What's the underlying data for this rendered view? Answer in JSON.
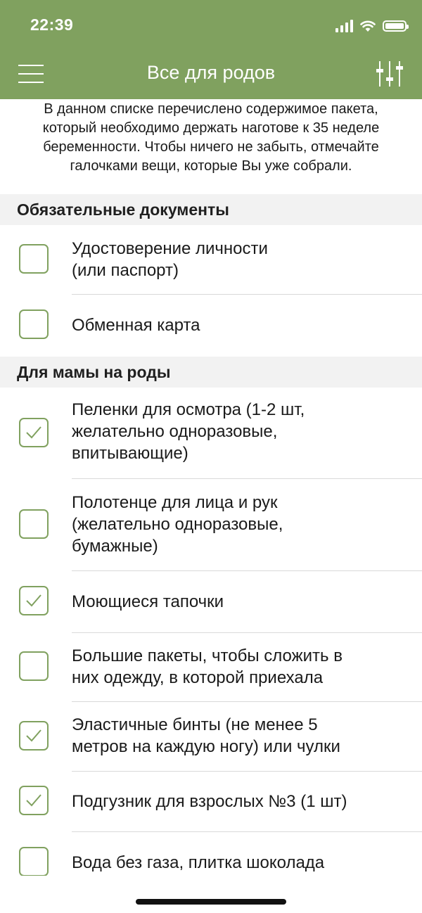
{
  "status_bar": {
    "time": "22:39"
  },
  "nav": {
    "title": "Все для родов",
    "left_icon": "hamburger-menu-icon",
    "right_icon": "filter-sliders-icon"
  },
  "intro_text": "В данном списке перечислено содержимое пакета, который необходимо держать наготове к 35 неделе беременности. Чтобы ничего не забыть, отмечайте галочками вещи, которые Вы уже собрали.",
  "sections": [
    {
      "title": "Обязательные документы",
      "items": [
        {
          "label": "Удостоверение личности\n(или паспорт)",
          "checked": false
        },
        {
          "label": "Обменная карта",
          "checked": false
        }
      ]
    },
    {
      "title": "Для мамы на роды",
      "items": [
        {
          "label": "Пеленки для осмотра (1-2 шт,\nжелательно одноразовые,\nвпитывающие)",
          "checked": true
        },
        {
          "label": "Полотенце для лица и рук\n(желательно одноразовые,\nбумажные)",
          "checked": false
        },
        {
          "label": "Моющиеся тапочки",
          "checked": true
        },
        {
          "label": "Большие пакеты, чтобы сложить в\nних одежду, в которой приехала",
          "checked": false
        },
        {
          "label": "Эластичные бинты (не менее 5\nметров на каждую ногу) или чулки",
          "checked": true
        },
        {
          "label": "Подгузник для взрослых №3 (1 шт)",
          "checked": true
        },
        {
          "label": "Вода без газа, плитка шоколада",
          "checked": false
        }
      ]
    }
  ],
  "colors": {
    "accent": "#80a15f",
    "section_bg": "#f2f2f2",
    "divider": "#d9d9d9"
  }
}
